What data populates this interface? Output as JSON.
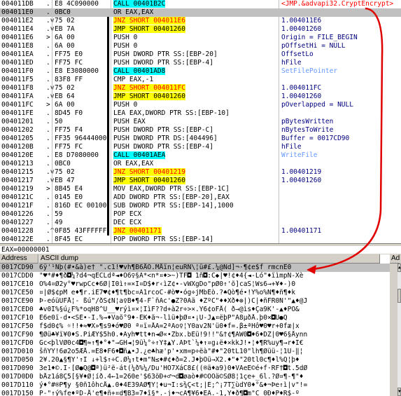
{
  "cpu_rows": [
    {
      "addr": "004011DB",
      "mark": ".",
      "hex": "E8 4C090000",
      "dis": "CALL 00401B2C",
      "hl": "call",
      "com": "<JMP.&advapi32.CryptEncrypt>",
      "comcls": "t-red"
    },
    {
      "addr": "004011E0",
      "mark": ".",
      "hex": "0BC0",
      "dis": "OR EAX,EAX",
      "hl": "",
      "com": "",
      "comcls": "",
      "sel": true
    },
    {
      "addr": "004011E2",
      "mark": ".v",
      "hex": "75 02",
      "dis": "JNZ SHORT 004011E6",
      "hl": "jcc",
      "com": "1.004011E6",
      "comcls": "t-navy"
    },
    {
      "addr": "004011E4",
      "mark": ".v",
      "hex": "EB 7A",
      "dis": "JMP SHORT 00401260",
      "hl": "jmp",
      "com": "1.00401260",
      "comcls": "t-navy"
    },
    {
      "addr": "004011E6",
      "mark": ">",
      "hex": "6A 00",
      "dis": "PUSH 0",
      "hl": "",
      "com": "Origin = FILE_BEGIN",
      "comcls": "t-navy"
    },
    {
      "addr": "004011E8",
      "mark": ".",
      "hex": "6A 00",
      "dis": "PUSH 0",
      "hl": "",
      "com": "pOffsetHi = NULL",
      "comcls": "t-navy"
    },
    {
      "addr": "004011EA",
      "mark": ".",
      "hex": "FF75 E0",
      "dis": "PUSH DWORD PTR SS:[EBP-20]",
      "hl": "",
      "com": "OffsetLo",
      "comcls": "t-navy"
    },
    {
      "addr": "004011ED",
      "mark": ".",
      "hex": "FF75 FC",
      "dis": "PUSH DWORD PTR SS:[EBP-4]",
      "hl": "",
      "com": "hFile",
      "comcls": "t-navy"
    },
    {
      "addr": "004011F0",
      "mark": ".",
      "hex": "E8 E3080000",
      "dis": "CALL 00401AD8",
      "hl": "call",
      "com": "SetFilePointer",
      "comcls": "t-ltblue"
    },
    {
      "addr": "004011F5",
      "mark": ".",
      "hex": "83F8 FF",
      "dis": "CMP EAX,-1",
      "hl": "",
      "com": "",
      "comcls": ""
    },
    {
      "addr": "004011F8",
      "mark": ".v",
      "hex": "75 02",
      "dis": "JNZ SHORT 004011FC",
      "hl": "jcc",
      "com": "1.004011FC",
      "comcls": "t-navy"
    },
    {
      "addr": "004011FA",
      "mark": ".v",
      "hex": "EB 64",
      "dis": "JMP SHORT 00401260",
      "hl": "jmp",
      "com": "1.00401260",
      "comcls": "t-navy"
    },
    {
      "addr": "004011FC",
      "mark": ">",
      "hex": "6A 00",
      "dis": "PUSH 0",
      "hl": "",
      "com": "pOverlapped = NULL",
      "comcls": "t-navy"
    },
    {
      "addr": "004011FE",
      "mark": ".",
      "hex": "8D45 F0",
      "dis": "LEA EAX,DWORD PTR SS:[EBP-10]",
      "hl": "",
      "com": "",
      "comcls": ""
    },
    {
      "addr": "00401201",
      "mark": ".",
      "hex": "50",
      "dis": "PUSH EAX",
      "hl": "",
      "com": "pBytesWritten",
      "comcls": "t-navy"
    },
    {
      "addr": "00401202",
      "mark": ".",
      "hex": "FF75 F4",
      "dis": "PUSH DWORD PTR SS:[EBP-C]",
      "hl": "",
      "com": "nBytesToWrite",
      "comcls": "t-navy"
    },
    {
      "addr": "00401205",
      "mark": ".",
      "hex": "FF35 96444000",
      "dis": "PUSH DWORD PTR DS:[404496]",
      "hl": "",
      "com": "Buffer = 0017CD90",
      "comcls": "t-navy"
    },
    {
      "addr": "0040120B",
      "mark": ".",
      "hex": "FF75 FC",
      "dis": "PUSH DWORD PTR SS:[EBP-4]",
      "hl": "",
      "com": "hFile",
      "comcls": "t-navy"
    },
    {
      "addr": "0040120E",
      "mark": ".",
      "hex": "E8 D7080000",
      "dis": "CALL 00401AEA",
      "hl": "call",
      "com": "WriteFile",
      "comcls": "t-ltblue"
    },
    {
      "addr": "00401213",
      "mark": ".",
      "hex": "0BC0",
      "dis": "OR EAX,EAX",
      "hl": "",
      "com": "",
      "comcls": ""
    },
    {
      "addr": "00401215",
      "mark": ".v",
      "hex": "75 02",
      "dis": "JNZ SHORT 00401219",
      "hl": "jcc",
      "com": "1.00401219",
      "comcls": "t-navy"
    },
    {
      "addr": "00401217",
      "mark": ".v",
      "hex": "EB 47",
      "dis": "JMP SHORT 00401260",
      "hl": "jmp",
      "com": "1.00401260",
      "comcls": "t-navy"
    },
    {
      "addr": "00401219",
      "mark": ">",
      "hex": "8B45 E4",
      "dis": "MOV EAX,DWORD PTR SS:[EBP-1C]",
      "hl": "",
      "com": "",
      "comcls": ""
    },
    {
      "addr": "0040121C",
      "mark": ".",
      "hex": "0145 E0",
      "dis": "ADD DWORD PTR SS:[EBP-20],EAX",
      "hl": "",
      "com": "",
      "comcls": ""
    },
    {
      "addr": "0040121F",
      "mark": ".",
      "hex": "816D EC 00100",
      "dis": "SUB DWORD PTR SS:[EBP-14],1000",
      "hl": "",
      "com": "",
      "comcls": ""
    },
    {
      "addr": "00401226",
      "mark": ".",
      "hex": "59",
      "dis": "POP ECX",
      "hl": "",
      "com": "",
      "comcls": ""
    },
    {
      "addr": "00401227",
      "mark": ".",
      "hex": "49",
      "dis": "DEC ECX",
      "hl": "",
      "com": "",
      "comcls": ""
    },
    {
      "addr": "00401228",
      "mark": ".^",
      "hex": "0F85 43FFFFFF",
      "dis": "JNZ 00401171",
      "hl": "jcc",
      "com": "1.00401171",
      "comcls": "t-navy"
    },
    {
      "addr": "0040122E",
      "mark": ".",
      "hex": "8F45 EC",
      "dis": "POP DWORD PTR SS:[EBP-14]",
      "hl": "",
      "com": "",
      "comcls": ""
    }
  ],
  "status_text": "EAX=00000001",
  "dump": {
    "col_address": "Address",
    "col_ascii": "ASCII dump",
    "stack_header": "Ad",
    "rows": [
      {
        "addr": "0017CD90",
        "ascii": "6ÿ'¹Nþ(#•&à)e† \".c1!♥vh¶B6ÅO.MÅïn¦euRÑ\\¦ü#£.¼@Nd]¬·¶¢e$f rmcnE0",
        "sel": true
      },
      {
        "addr": "0017CDD0",
        "ascii": "\"♥*#♦¶ð◘¼?d4¬qECLdª◄♦Ö6♀§Ä*<n*¤♦>~)TF◘ 1ñ◘:C◆|♥!¢♦4{◄-Ló\"♦ïìmpÑ-Xè"
      },
      {
        "addr": "0017CE10",
        "ascii": "Ô%4¤Ø2y°♥rwpCc♦6Ø|I0ì↑=×I¤D$♦r‹ìZ¢∙-vWXgDo\"pØ0↑'õ]caS¦Ws6→+¥♦-)0"
      },
      {
        "addr": "0017CE50",
        "ascii": "¤|Ø$¢pM e♦¶r.iE7♥¢♦¶t¶bc¤Ä1rcoC-#ò♥∙óg÷jMbEò.?♠Qò¶é∙!Y%o%N¶♦ñ¶♦k"
      },
      {
        "addr": "0017CE90",
        "ascii": "Þ-eóüUFÅ¦- ßú\"/ðS¢N¦a♀B♦¶4-F`ñAc'●Z?0Aä ♦ZºC\"♦♦Xð♦⊕|)C|♦ñFR0Ñ'\"▲♦@J"
      },
      {
        "addr": "0017CED0",
        "ascii": "♣v0Ï%§ú¿F%*oqH8^U__♥rýì¤×¦IìF??d+à2r÷>×.Y6¢oFÅ( ð→@ìs♦Ça9K'-▲♦PO&"
      },
      {
        "addr": "0017CF10",
        "ascii": "E6e0ï-d•<SÉ•-I.%→♦Vaõ°9♦-ÉK♦ã¬-lìü♦þØ¤∙¡Ü-J▲¤ëþP\"À8µðÅ.þ0×◘Ü●Q"
      },
      {
        "addr": "0017CF50",
        "ascii": "f$d0¢% ☼!!♦≈♥X»¶s9♦ó♥Ø0 ª¤ï¤ÅA=2ªÃo♀¦Y0av2N'ü0♦f=.β±ªHô♥0♥r+0fæ|x"
      },
      {
        "addr": "0017CF90",
        "ascii": "¶Øü♣¥ï¥0♦S.PiÆÝ$5h0.♦Äyh♥tt♦n◄Ø«•Zbx.bEü!9!!\"&†¢¶ÄW0◘♦6♦DZ|0♥6§Åynn"
      },
      {
        "addr": "0017CFD0",
        "ascii": "Gc<þlVØ0c4◘¶≈↑¶♦°♦\"→GH◄¦9ü¼°÷↑Y‡▲Y.AÞt`¼♦↑¤g↓ë♦×kkJ!∙¦♦¶R%uy¶→r♦Ï€"
      },
      {
        "addr": "0017D010",
        "ascii": "šñYY!6ø2o5ÆÅ.=E8♦F6♦◘ñ▲•J.¿e♣hæ'p'•xm=p÷ëà\"#♦\"20tL10\"lh¶Øüü-¦1Ü-‖¦"
      },
      {
        "addr": "0017D050",
        "ascii": "2¥.20▲§¶Y'↑I ↓+l$↑÷C.Ø¼↑t♦m\"Ñ≤♦#¢♦ð=2.J♦þÔü→X2.♦\"♦\"20tl0c¶♦l%Q¦þ♦"
      },
      {
        "addr": "0017D090",
        "ascii": "3e1♦©.Ï·[Ø●Q@◘ª)ü²ë-át(¼ð%¼/Du'HO7XáC8£((®ä♦a9)0♦VÄeE©é+f·RF†◘t.5dØ"
      },
      {
        "addr": "0017D0D0",
        "ascii": "bÅz1á8Ç5[§¥♦Ø¦íð.4←1=260e'$63öÐ+♂¬d◘øaò♦#©ÖÖä©SØ8¦1çe+_6l.?Ø¤¶-¶\"♦"
      },
      {
        "addr": "0017D110",
        "ascii": "ý♦°#®P¶y §0ñ1ôhcÅ▲.0♦4E39AØ¶Y¦♦u¬I:s¾Ç<t;|E;^¡7T∑ùdY0♦°&♦¬Þe↑ì|v\"!="
      },
      {
        "addr": "0017D150",
        "ascii": "P-\"↑ý%fe♦ºD-Å'e¶♦ñ+¤d¶B3=7♦î§*.-j♦¬cA¶¥6♦EÂ.-1,Y♦ð¶◘m\"C_0Ð♦P♦R$-º"
      }
    ]
  }
}
